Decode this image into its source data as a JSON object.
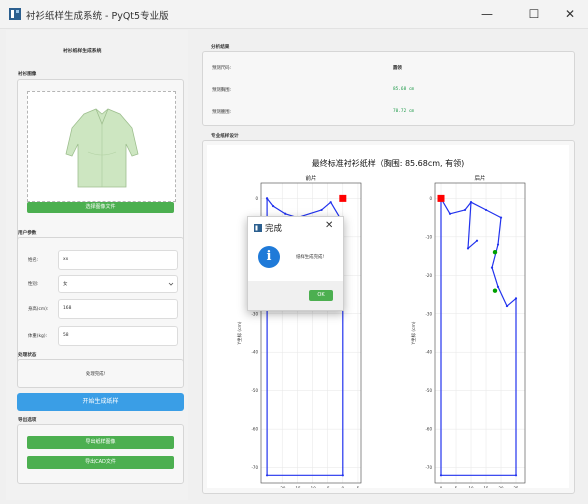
{
  "window": {
    "title": "衬衫纸样生成系统 - PyQt5专业版",
    "minimize_glyph": "—",
    "maximize_glyph": "☐",
    "close_glyph": "✕"
  },
  "left": {
    "header": "衬衫纸样生成系统",
    "image_group": {
      "label": "衬衫图像",
      "select_button": "选择图像文件"
    },
    "params_group": {
      "label": "用户参数",
      "fields": [
        {
          "label": "姓名:",
          "value": "xx"
        },
        {
          "label": "性别:",
          "value": "女"
        },
        {
          "label": "身高(cm):",
          "value": "168"
        },
        {
          "label": "体重(kg):",
          "value": "58"
        }
      ]
    },
    "status_group": {
      "label": "处理状态",
      "status_text": "处理完成!"
    },
    "start_button": "开始生成纸样",
    "export_group": {
      "label": "导出选项",
      "buttons": [
        "导出纸样图像",
        "导出CAD文件"
      ]
    }
  },
  "results": {
    "label": "分析结果",
    "rows": [
      {
        "label": "预测尺码:",
        "value": "圆领"
      },
      {
        "label": "预测胸围:",
        "value": "85.68 cm"
      },
      {
        "label": "预测腰围:",
        "value": "70.72 cm"
      }
    ]
  },
  "viz": {
    "label": "专业纸样设计"
  },
  "chart_data": [
    {
      "type": "line",
      "title": "最终标准衬衫纸样（胸围: 85.68cm, 有领)",
      "subtitle": "前片",
      "xlabel": "X坐标 (cm)",
      "ylabel": "Y坐标 (cm)",
      "xlim": [
        -27,
        6
      ],
      "ylim": [
        -74,
        4
      ],
      "xticks": [
        "-20",
        "-15",
        "-10",
        "-5",
        "0",
        "5"
      ],
      "yticks": [
        "0",
        "-10",
        "-20",
        "-30",
        "-40",
        "-50",
        "-60",
        "-70"
      ],
      "grid": true,
      "series": [
        {
          "values": [
            [
              -25,
              0
            ],
            [
              -23,
              -2
            ],
            [
              -19,
              -4
            ],
            [
              -15,
              -5
            ],
            [
              -7,
              -3
            ],
            [
              -4,
              -1
            ],
            [
              -1,
              -5
            ],
            [
              -1,
              -10
            ],
            [
              0,
              -28
            ],
            [
              0,
              -72
            ],
            [
              -25,
              -72
            ],
            [
              -25,
              0
            ]
          ]
        }
      ],
      "markers": [
        {
          "x": 0,
          "y": 0,
          "color": "#ff0000",
          "shape": "square"
        }
      ]
    },
    {
      "type": "line",
      "subtitle": "后片",
      "xlabel": "X坐标 (cm)",
      "ylabel": "Y坐标 (cm)",
      "xlim": [
        -2,
        28
      ],
      "ylim": [
        -74,
        4
      ],
      "xticks": [
        "0",
        "5",
        "10",
        "15",
        "20",
        "25"
      ],
      "yticks": [
        "0",
        "-10",
        "-20",
        "-30",
        "-40",
        "-50",
        "-60",
        "-70"
      ],
      "grid": true,
      "series": [
        {
          "values": [
            [
              0,
              0
            ],
            [
              3,
              -4
            ],
            [
              8,
              -3
            ],
            [
              10,
              -1
            ],
            [
              15,
              -3
            ],
            [
              20,
              -5
            ],
            [
              19,
              -12
            ],
            [
              17,
              -18
            ],
            [
              19,
              -23
            ],
            [
              22,
              -28
            ],
            [
              25,
              -26
            ],
            [
              25,
              -72
            ],
            [
              0,
              -72
            ],
            [
              0,
              0
            ]
          ]
        },
        {
          "values": [
            [
              10,
              -1
            ],
            [
              9,
              -13
            ],
            [
              12,
              -11
            ]
          ]
        }
      ],
      "markers": [
        {
          "x": 0,
          "y": 0,
          "color": "#ff0000",
          "shape": "square"
        },
        {
          "x": 18,
          "y": -14,
          "color": "#00a000",
          "shape": "circle"
        },
        {
          "x": 18,
          "y": -24,
          "color": "#00a000",
          "shape": "circle"
        }
      ]
    }
  ],
  "dialog": {
    "title": "完成",
    "message": "纸样生成完成!",
    "ok_button": "OK",
    "close_glyph": "✕",
    "info_glyph": "i"
  }
}
